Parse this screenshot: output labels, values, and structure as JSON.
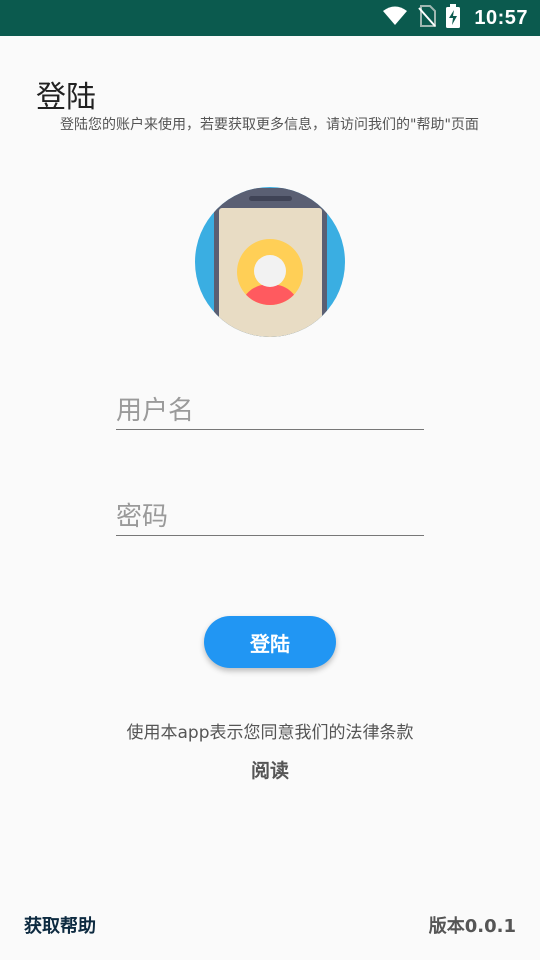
{
  "status_bar": {
    "time": "10:57",
    "icons": [
      "wifi-icon",
      "no-sim-icon",
      "battery-charging-icon"
    ]
  },
  "header": {
    "title": "登陆",
    "subtitle": "登陆您的账户来使用，若要获取更多信息，请访问我们的\"帮助\"页面"
  },
  "illustration": {
    "icon": "phone-user-avatar-icon",
    "colors": {
      "circle": "#3aaee2",
      "phone_body": "#5a5f73",
      "screen": "#e8dcc4",
      "avatar_ring": "#ffcf56",
      "avatar_face": "#f2f2f2",
      "avatar_shoulders": "#ff5a5f"
    }
  },
  "form": {
    "username_placeholder": "用户名",
    "password_placeholder": "密码",
    "submit_label": "登陆"
  },
  "terms": {
    "text": "使用本app表示您同意我们的法律条款",
    "read_label": "阅读"
  },
  "footer": {
    "help_label": "获取帮助",
    "version": "版本0.0.1"
  },
  "colors": {
    "status_bar": "#0b5a4e",
    "accent": "#2196f3",
    "background": "#fafafa"
  }
}
